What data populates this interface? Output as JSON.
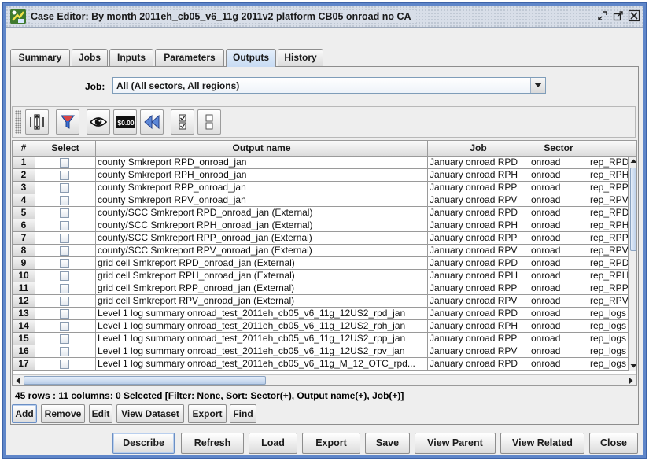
{
  "window": {
    "title": "Case Editor: By month 2011eh_cb05_v6_11g 2011v2 platform CB05 onroad no CA"
  },
  "tabs": [
    {
      "label": "Summary",
      "active": false
    },
    {
      "label": "Jobs",
      "active": false
    },
    {
      "label": "Inputs",
      "active": false
    },
    {
      "label": "Parameters",
      "active": false
    },
    {
      "label": "Outputs",
      "active": true
    },
    {
      "label": "History",
      "active": false
    }
  ],
  "job_filter": {
    "label": "Job:",
    "value": "All (All sectors, All regions)"
  },
  "toolbar": {
    "tools": [
      "columns-icon",
      "filter-icon",
      "view-eye-icon",
      "format-icon",
      "rewind-icon",
      "select-all-icon",
      "clear-selection-icon"
    ],
    "format_label": "$0.00"
  },
  "table": {
    "columns": [
      "#",
      "Select",
      "Output name",
      "Job",
      "Sector",
      ""
    ],
    "rows": [
      {
        "num": "1",
        "output": "county Smkreport RPD_onroad_jan",
        "job": "January onroad RPD",
        "sector": "onroad",
        "extra": "rep_RPD"
      },
      {
        "num": "2",
        "output": "county Smkreport RPH_onroad_jan",
        "job": "January onroad RPH",
        "sector": "onroad",
        "extra": "rep_RPH"
      },
      {
        "num": "3",
        "output": "county Smkreport RPP_onroad_jan",
        "job": "January onroad RPP",
        "sector": "onroad",
        "extra": "rep_RPP"
      },
      {
        "num": "4",
        "output": "county Smkreport RPV_onroad_jan",
        "job": "January onroad RPV",
        "sector": "onroad",
        "extra": "rep_RPV"
      },
      {
        "num": "5",
        "output": "county/SCC Smkreport RPD_onroad_jan (External)",
        "job": "January onroad RPD",
        "sector": "onroad",
        "extra": "rep_RPD"
      },
      {
        "num": "6",
        "output": "county/SCC Smkreport RPH_onroad_jan (External)",
        "job": "January onroad RPH",
        "sector": "onroad",
        "extra": "rep_RPH"
      },
      {
        "num": "7",
        "output": "county/SCC Smkreport RPP_onroad_jan (External)",
        "job": "January onroad RPP",
        "sector": "onroad",
        "extra": "rep_RPP"
      },
      {
        "num": "8",
        "output": "county/SCC Smkreport RPV_onroad_jan (External)",
        "job": "January onroad RPV",
        "sector": "onroad",
        "extra": "rep_RPV"
      },
      {
        "num": "9",
        "output": "grid cell Smkreport RPD_onroad_jan (External)",
        "job": "January onroad RPD",
        "sector": "onroad",
        "extra": "rep_RPD"
      },
      {
        "num": "10",
        "output": "grid cell Smkreport RPH_onroad_jan (External)",
        "job": "January onroad RPH",
        "sector": "onroad",
        "extra": "rep_RPH"
      },
      {
        "num": "11",
        "output": "grid cell Smkreport RPP_onroad_jan (External)",
        "job": "January onroad RPP",
        "sector": "onroad",
        "extra": "rep_RPP"
      },
      {
        "num": "12",
        "output": "grid cell Smkreport RPV_onroad_jan (External)",
        "job": "January onroad RPV",
        "sector": "onroad",
        "extra": "rep_RPV"
      },
      {
        "num": "13",
        "output": "Level 1 log summary onroad_test_2011eh_cb05_v6_11g_12US2_rpd_jan",
        "job": "January onroad RPD",
        "sector": "onroad",
        "extra": "rep_logs"
      },
      {
        "num": "14",
        "output": "Level 1 log summary onroad_test_2011eh_cb05_v6_11g_12US2_rph_jan",
        "job": "January onroad RPH",
        "sector": "onroad",
        "extra": "rep_logs"
      },
      {
        "num": "15",
        "output": "Level 1 log summary onroad_test_2011eh_cb05_v6_11g_12US2_rpp_jan",
        "job": "January onroad RPP",
        "sector": "onroad",
        "extra": "rep_logs"
      },
      {
        "num": "16",
        "output": "Level 1 log summary onroad_test_2011eh_cb05_v6_11g_12US2_rpv_jan",
        "job": "January onroad RPV",
        "sector": "onroad",
        "extra": "rep_logs"
      },
      {
        "num": "17",
        "output": "Level 1 log summary onroad_test_2011eh_cb05_v6_11g_M_12_OTC_rpd...",
        "job": "January onroad RPD",
        "sector": "onroad",
        "extra": "rep_logs"
      }
    ]
  },
  "status": "45 rows : 11 columns: 0 Selected [Filter: None, Sort: Sector(+), Output name(+), Job(+)]",
  "table_buttons": [
    {
      "label": "Add",
      "name": "add-button"
    },
    {
      "label": "Remove",
      "name": "remove-button"
    },
    {
      "label": "Edit",
      "name": "edit-button"
    },
    {
      "label": "View Dataset",
      "name": "view-dataset-button"
    },
    {
      "label": "Export",
      "name": "export-table-button"
    },
    {
      "label": "Find",
      "name": "find-button"
    }
  ],
  "footer_buttons": [
    {
      "label": "Describe",
      "name": "describe-button"
    },
    {
      "label": "Refresh",
      "name": "refresh-button"
    },
    {
      "label": "Load",
      "name": "load-button"
    },
    {
      "label": "Export",
      "name": "export-button"
    },
    {
      "label": "Save",
      "name": "save-button"
    },
    {
      "label": "View Parent",
      "name": "view-parent-button"
    },
    {
      "label": "View Related",
      "name": "view-related-button"
    },
    {
      "label": "Close",
      "name": "close-button"
    }
  ]
}
